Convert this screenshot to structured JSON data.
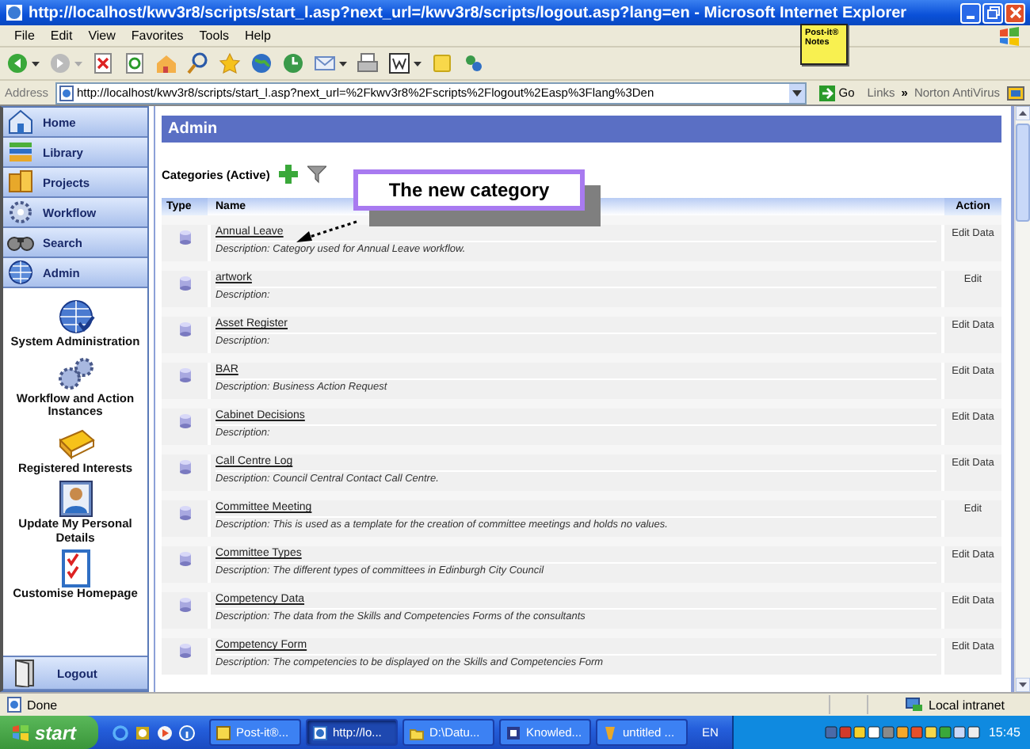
{
  "window": {
    "title": "http://localhost/kwv3r8/scripts/start_l.asp?next_url=/kwv3r8/scripts/logout.asp?lang=en - Microsoft Internet Explorer"
  },
  "menu": [
    "File",
    "Edit",
    "View",
    "Favorites",
    "Tools",
    "Help"
  ],
  "post_it": {
    "label": "Post-it® Notes"
  },
  "address_bar": {
    "label": "Address",
    "url": "http://localhost/kwv3r8/scripts/start_l.asp?next_url=%2Fkwv3r8%2Fscripts%2Flogout%2Easp%3Flang%3Den",
    "go": "Go",
    "links": "Links",
    "chevron": "»",
    "extension": "Norton AntiVirus"
  },
  "sidebar": {
    "nav": [
      "Home",
      "Library",
      "Projects",
      "Workflow",
      "Search",
      "Admin"
    ],
    "admin_links": [
      "System Administration",
      "Workflow and Action Instances",
      "Registered Interests",
      "Update My Personal Details",
      "Customise Homepage"
    ],
    "logout": "Logout"
  },
  "page": {
    "heading": "Admin",
    "list_title": "Categories (Active)",
    "columns": [
      "Type",
      "Name",
      "Action"
    ],
    "rows": [
      {
        "name": "Annual Leave",
        "description": "Description: Category used for Annual Leave workflow.",
        "action": "Edit Data"
      },
      {
        "name": "artwork",
        "description": "Description:",
        "action": "Edit"
      },
      {
        "name": "Asset Register",
        "description": "Description:",
        "action": "Edit Data"
      },
      {
        "name": "BAR",
        "description": "Description: Business Action Request",
        "action": "Edit Data"
      },
      {
        "name": "Cabinet Decisions",
        "description": "Description:",
        "action": "Edit Data"
      },
      {
        "name": "Call Centre Log",
        "description": "Description: Council Central Contact Call Centre.",
        "action": "Edit Data"
      },
      {
        "name": "Committee Meeting",
        "description": "Description: This is used as a template for the creation of committee meetings and holds no values.",
        "action": "Edit"
      },
      {
        "name": "Committee Types",
        "description": "Description: The different types of committees in Edinburgh City Council",
        "action": "Edit Data"
      },
      {
        "name": "Competency Data",
        "description": "Description: The data from the Skills and Competencies Forms of the consultants",
        "action": "Edit Data"
      },
      {
        "name": "Competency Form",
        "description": "Description: The competencies to be displayed on the Skills and Competencies Form",
        "action": "Edit Data"
      }
    ]
  },
  "callout": {
    "text": "The new category"
  },
  "status_bar": {
    "text": "Done",
    "zone": "Local intranet"
  },
  "taskbar": {
    "start": "start",
    "tasks": [
      {
        "label": "Post-it®...",
        "selected": false
      },
      {
        "label": "http://lo...",
        "selected": true
      },
      {
        "label": "D:\\Datu...",
        "selected": false
      },
      {
        "label": "Knowled...",
        "selected": false
      },
      {
        "label": "untitled ...",
        "selected": false
      }
    ],
    "language": "EN",
    "clock": "15:45"
  }
}
